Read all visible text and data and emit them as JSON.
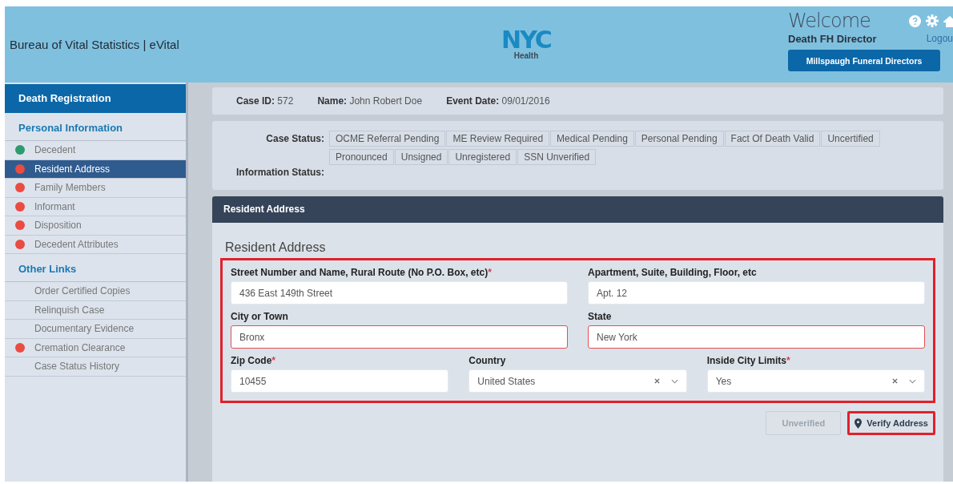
{
  "header": {
    "title": "Bureau of Vital Statistics | eVital",
    "logo": {
      "mark": "NYC",
      "sub": "Health"
    },
    "welcome": "Welcome",
    "user": "Death FH Director",
    "logout": "Logou",
    "organization": "Millspaugh Funeral Directors"
  },
  "sidebar": {
    "title": "Death Registration",
    "sections": [
      {
        "heading": "Personal Information",
        "items": [
          {
            "label": "Decedent",
            "color": "#2e9b6e",
            "selected": false
          },
          {
            "label": "Resident Address",
            "color": "#ea4b43",
            "selected": true
          },
          {
            "label": "Family Members",
            "color": "#ea4b43",
            "selected": false
          },
          {
            "label": "Informant",
            "color": "#ea4b43",
            "selected": false
          },
          {
            "label": "Disposition",
            "color": "#ea4b43",
            "selected": false
          },
          {
            "label": "Decedent Attributes",
            "color": "#ea4b43",
            "selected": false
          }
        ]
      },
      {
        "heading": "Other Links",
        "items": [
          {
            "label": "Order Certified Copies",
            "selected": false
          },
          {
            "label": "Relinquish Case",
            "selected": false
          },
          {
            "label": "Documentary Evidence",
            "selected": false
          },
          {
            "label": "Cremation Clearance",
            "color": "#ea4b43",
            "selected": false
          },
          {
            "label": "Case Status History",
            "selected": false
          }
        ]
      }
    ]
  },
  "case_bar": [
    {
      "label": "Case ID:",
      "value": "572"
    },
    {
      "label": "Name:",
      "value": "John Robert Doe"
    },
    {
      "label": "Event Date:",
      "value": "09/01/2016"
    }
  ],
  "status": {
    "case_label": "Case Status:",
    "tags": [
      "OCME Referral Pending",
      "ME Review Required",
      "Medical Pending",
      "Personal Pending",
      "Fact Of Death Valid",
      "Uncertified",
      "Pronounced",
      "Unsigned",
      "Unregistered",
      "SSN Unverified"
    ],
    "info_label": "Information Status:"
  },
  "panel": {
    "title": "Resident Address",
    "subtitle": "Resident Address",
    "highlighted": true,
    "rows": [
      [
        {
          "kind": "text",
          "label": "Street Number and Name, Rural Route (No P.O. Box, etc)",
          "required_mark": "*",
          "value": "436 East 149th Street",
          "error": false
        },
        {
          "kind": "text",
          "label": "Apartment, Suite, Building, Floor, etc",
          "value": "Apt. 12",
          "error": false
        }
      ],
      [
        {
          "kind": "text",
          "label": "City or Town",
          "value": "Bronx",
          "error": true
        },
        {
          "kind": "text",
          "label": "State",
          "value": "New York",
          "error": true
        }
      ],
      [
        {
          "kind": "text",
          "label": "Zip Code",
          "required_mark": "*",
          "value": "10455",
          "error": false
        },
        {
          "kind": "select",
          "label": "Country",
          "value": "United States",
          "error": false
        },
        {
          "kind": "select",
          "label": "Inside City Limits",
          "required_mark": "*",
          "value": "Yes",
          "error": false
        }
      ]
    ],
    "status_button": {
      "label": "Unverified",
      "disabled": true
    },
    "verify_button": {
      "label": "Verify Address",
      "highlighted": true
    }
  }
}
